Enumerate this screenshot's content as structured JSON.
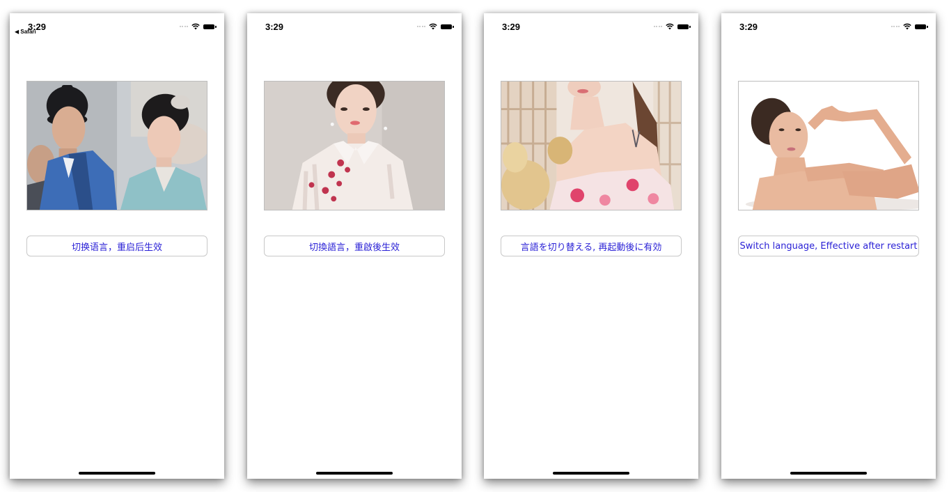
{
  "screens": [
    {
      "time": "3:29",
      "back_app": "◀ Safari",
      "button_label": "切换语言，重启后生效",
      "image": "costume-drama-couple-photo"
    },
    {
      "time": "3:29",
      "back_app": "",
      "button_label": "切換語言，重啟後生效",
      "image": "qipao-portrait-photo"
    },
    {
      "time": "3:29",
      "back_app": "",
      "button_label": "言語を切り替える, 再起動後に有効",
      "image": "kimono-shoulder-photo"
    },
    {
      "time": "3:29",
      "back_app": "",
      "button_label": "Switch language, Effective after restart",
      "image": "beauty-model-photo"
    }
  ],
  "icons": {
    "signal": "cellular-signal-icon",
    "wifi": "wifi-icon",
    "battery": "battery-icon"
  },
  "colors": {
    "button_text": "#2b22d6",
    "button_border": "#c8c8c8",
    "background": "#ffffff"
  }
}
